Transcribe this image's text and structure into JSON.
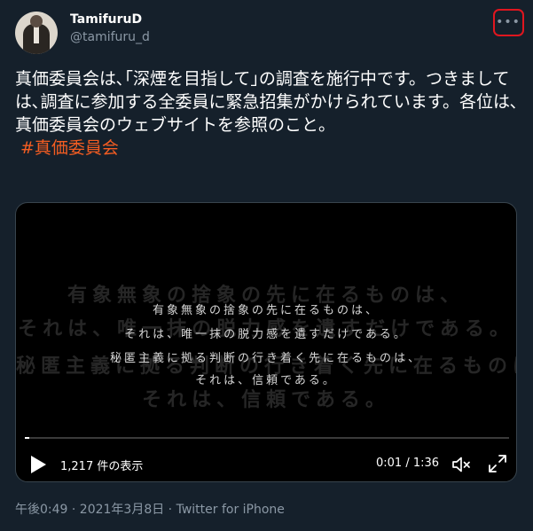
{
  "author": {
    "name": "TamifuruD",
    "handle": "@tamifuru_d"
  },
  "tweet": {
    "text": "真価委員会は､｢深煙を目指して｣の調査を施行中です。つきましては､調査に参加する全委員に緊急招集がかけられています。各位は､真価委員会のウェブサイトを参照のこと。",
    "hashtag": "#真価委員会"
  },
  "video": {
    "ghost_lines": [
      "有象無象の捨象の先に在るものは、",
      "それは、唯一抹の脱力感を遺すだけである。",
      "秘匿主義に拠る判断の行き着く先に在るものは、",
      "それは、信頼である。"
    ],
    "subtitles": [
      "有象無象の捨象の先に在るものは、",
      "それは、唯一抹の脱力感を遺すだけである。",
      "秘匿主義に拠る判断の行き着く先に在るものは、",
      "それは、信頼である。"
    ],
    "views": "1,217 件の表示",
    "time": "0:01 / 1:36",
    "progress": 0.01
  },
  "meta": "午後0:49 · 2021年3月8日 · Twitter for iPhone",
  "icons": {
    "more": "more-dots-icon",
    "play": "play-icon",
    "mute": "volume-muted-icon",
    "fullscreen": "fullscreen-icon"
  },
  "colors": {
    "background": "#15202b",
    "hashtag": "#f45d22",
    "secondary": "#8b98a5",
    "annotation": "#e0161f"
  }
}
